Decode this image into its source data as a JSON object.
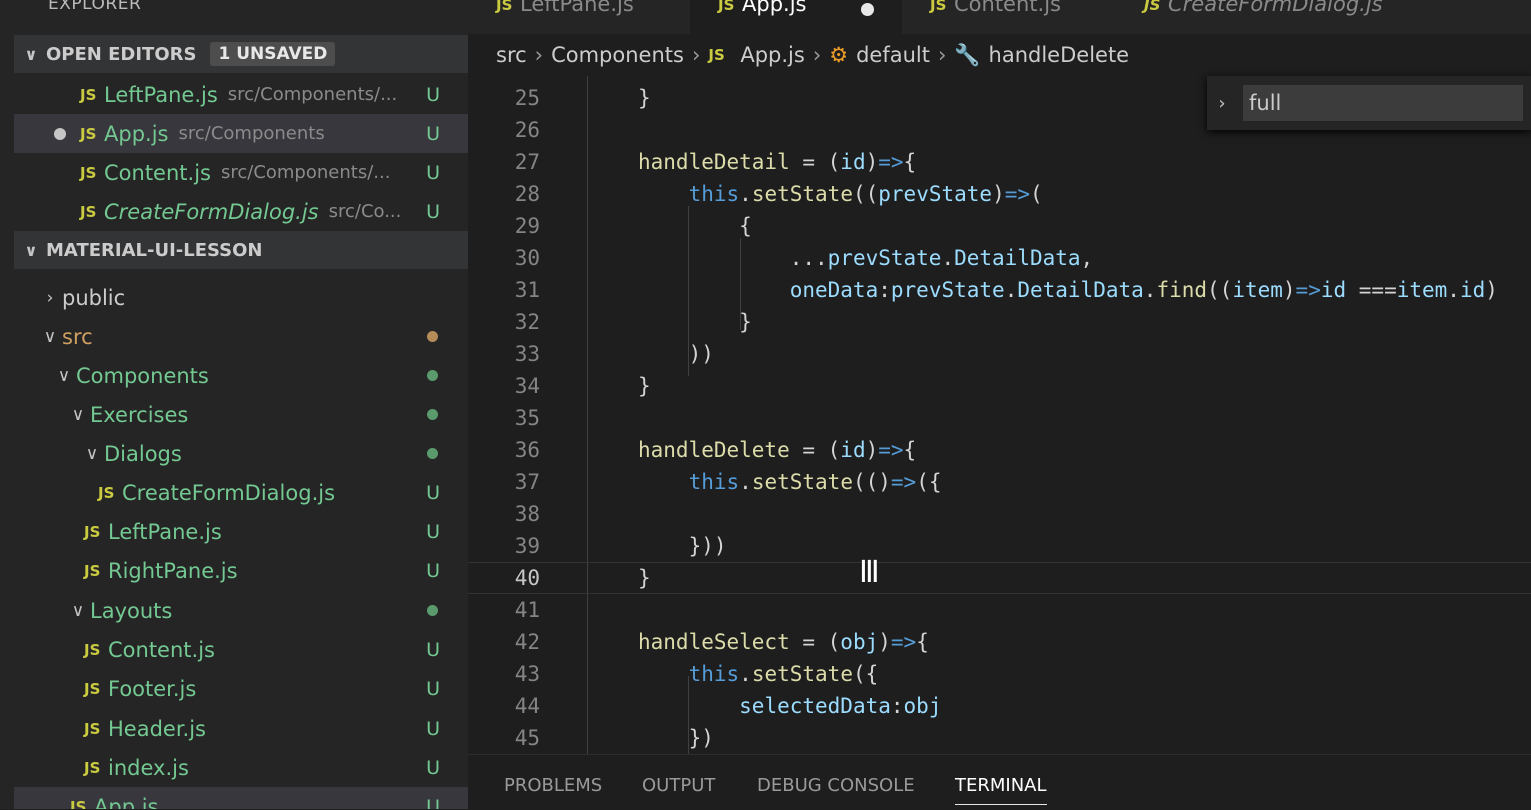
{
  "sidebar": {
    "title": "EXPLORER",
    "open_editors": {
      "label": "OPEN EDITORS",
      "badge": "1 UNSAVED",
      "items": [
        {
          "name": "LeftPane.js",
          "path": "src/Components/...",
          "status": "U"
        },
        {
          "name": "App.js",
          "path": "src/Components",
          "status": "U"
        },
        {
          "name": "Content.js",
          "path": "src/Components/...",
          "status": "U"
        },
        {
          "name": "CreateFormDialog.js",
          "path": "src/Co...",
          "status": "U"
        }
      ]
    },
    "project": {
      "label": "MATERIAL-UI-LESSON",
      "tree": [
        {
          "name": "public"
        },
        {
          "name": "src"
        },
        {
          "name": "Components"
        },
        {
          "name": "Exercises"
        },
        {
          "name": "Dialogs"
        },
        {
          "name": "CreateFormDialog.js",
          "status": "U"
        },
        {
          "name": "LeftPane.js",
          "status": "U"
        },
        {
          "name": "RightPane.js",
          "status": "U"
        },
        {
          "name": "Layouts"
        },
        {
          "name": "Content.js",
          "status": "U"
        },
        {
          "name": "Footer.js",
          "status": "U"
        },
        {
          "name": "Header.js",
          "status": "U"
        },
        {
          "name": "index.js",
          "status": "U"
        },
        {
          "name": "App.js",
          "status": "U"
        }
      ]
    }
  },
  "tabs": [
    {
      "label": "LeftPane.js"
    },
    {
      "label": "App.js"
    },
    {
      "label": "Content.js"
    },
    {
      "label": "CreateFormDialog.js"
    }
  ],
  "js_badge": "JS",
  "breadcrumb": {
    "parts": [
      "src",
      "Components",
      "App.js",
      "default",
      "handleDelete"
    ]
  },
  "find_widget": {
    "value": "full"
  },
  "editor": {
    "lines": [
      {
        "num": "25",
        "code": "}"
      },
      {
        "num": "26",
        "code": ""
      },
      {
        "num": "27",
        "code": "handleDetail = (id)=>{"
      },
      {
        "num": "28",
        "code": "    this.setState((prevState)=>("
      },
      {
        "num": "29",
        "code": "        {"
      },
      {
        "num": "30",
        "code": "            ...prevState.DetailData,"
      },
      {
        "num": "31",
        "code": "            oneData:prevState.DetailData.find((item)=>id ===item.id)"
      },
      {
        "num": "32",
        "code": "        }"
      },
      {
        "num": "33",
        "code": "    ))"
      },
      {
        "num": "34",
        "code": "}"
      },
      {
        "num": "35",
        "code": ""
      },
      {
        "num": "36",
        "code": "handleDelete = (id)=>{"
      },
      {
        "num": "37",
        "code": "    this.setState(()=>({"
      },
      {
        "num": "38",
        "code": ""
      },
      {
        "num": "39",
        "code": "    }))"
      },
      {
        "num": "40",
        "code": "}"
      },
      {
        "num": "41",
        "code": ""
      },
      {
        "num": "42",
        "code": "handleSelect = (obj)=>{"
      },
      {
        "num": "43",
        "code": "    this.setState({"
      },
      {
        "num": "44",
        "code": "        selectedData:obj"
      },
      {
        "num": "45",
        "code": "    })"
      }
    ]
  },
  "panel": {
    "tabs": [
      "PROBLEMS",
      "OUTPUT",
      "DEBUG CONSOLE",
      "TERMINAL"
    ]
  },
  "colors": {
    "modified_green": "#73c991",
    "js_yellow": "#cbcb41",
    "keyword_blue": "#569cd6",
    "function_yellow": "#dcdcaa",
    "variable_lightblue": "#9cdcfe"
  }
}
